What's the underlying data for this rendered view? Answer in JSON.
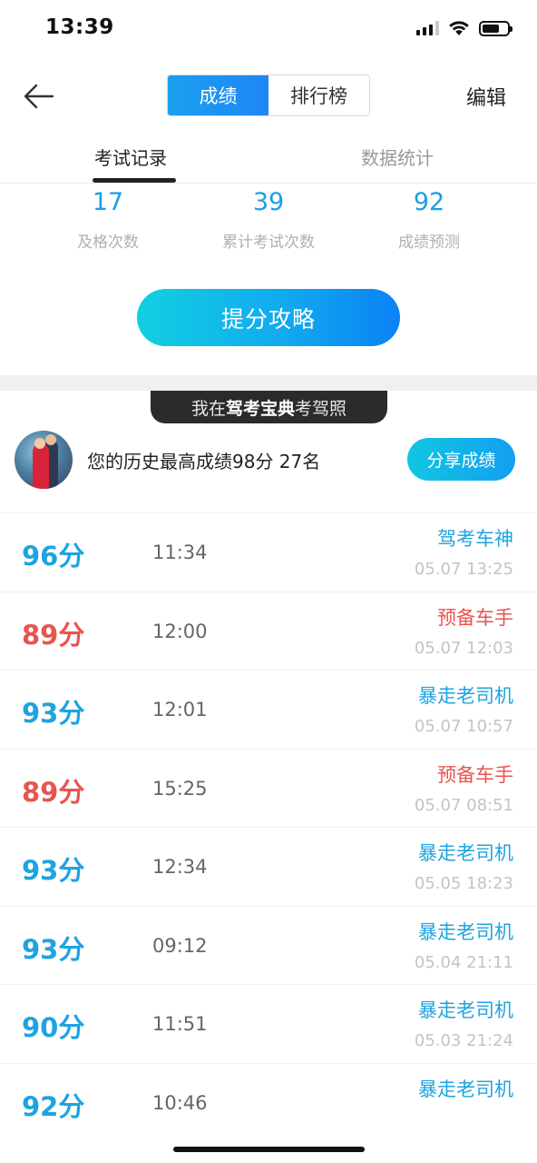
{
  "status_bar": {
    "time": "13:39",
    "battery_level": 0.7
  },
  "header": {
    "tabs": [
      {
        "label": "成绩",
        "active": true
      },
      {
        "label": "排行榜",
        "active": false
      }
    ],
    "edit_label": "编辑"
  },
  "subtabs": [
    {
      "label": "考试记录",
      "active": true
    },
    {
      "label": "数据统计",
      "active": false
    }
  ],
  "stats": [
    {
      "value": "17",
      "label": "及格次数"
    },
    {
      "value": "39",
      "label": "累计考试次数"
    },
    {
      "value": "92",
      "label": "成绩预测"
    }
  ],
  "tips_button": "提分攻略",
  "banner": {
    "prefix": "我在",
    "brand": "驾考宝典",
    "suffix": "考驾照"
  },
  "best": {
    "text": "您的历史最高成绩98分  27名",
    "share_label": "分享成绩"
  },
  "colors": {
    "accent_blue": "#1fa3e0",
    "fail_red": "#e8544f"
  },
  "records": [
    {
      "score": "96分",
      "duration": "11:34",
      "title": "驾考车神",
      "date": "05.07 13:25",
      "tone": "blue"
    },
    {
      "score": "89分",
      "duration": "12:00",
      "title": "预备车手",
      "date": "05.07 12:03",
      "tone": "red"
    },
    {
      "score": "93分",
      "duration": "12:01",
      "title": "暴走老司机",
      "date": "05.07 10:57",
      "tone": "blue"
    },
    {
      "score": "89分",
      "duration": "15:25",
      "title": "预备车手",
      "date": "05.07 08:51",
      "tone": "red"
    },
    {
      "score": "93分",
      "duration": "12:34",
      "title": "暴走老司机",
      "date": "05.05 18:23",
      "tone": "blue"
    },
    {
      "score": "93分",
      "duration": "09:12",
      "title": "暴走老司机",
      "date": "05.04 21:11",
      "tone": "blue"
    },
    {
      "score": "90分",
      "duration": "11:51",
      "title": "暴走老司机",
      "date": "05.03 21:24",
      "tone": "blue"
    },
    {
      "score": "92分",
      "duration": "10:46",
      "title": "暴走老司机",
      "date": "",
      "tone": "blue"
    }
  ]
}
